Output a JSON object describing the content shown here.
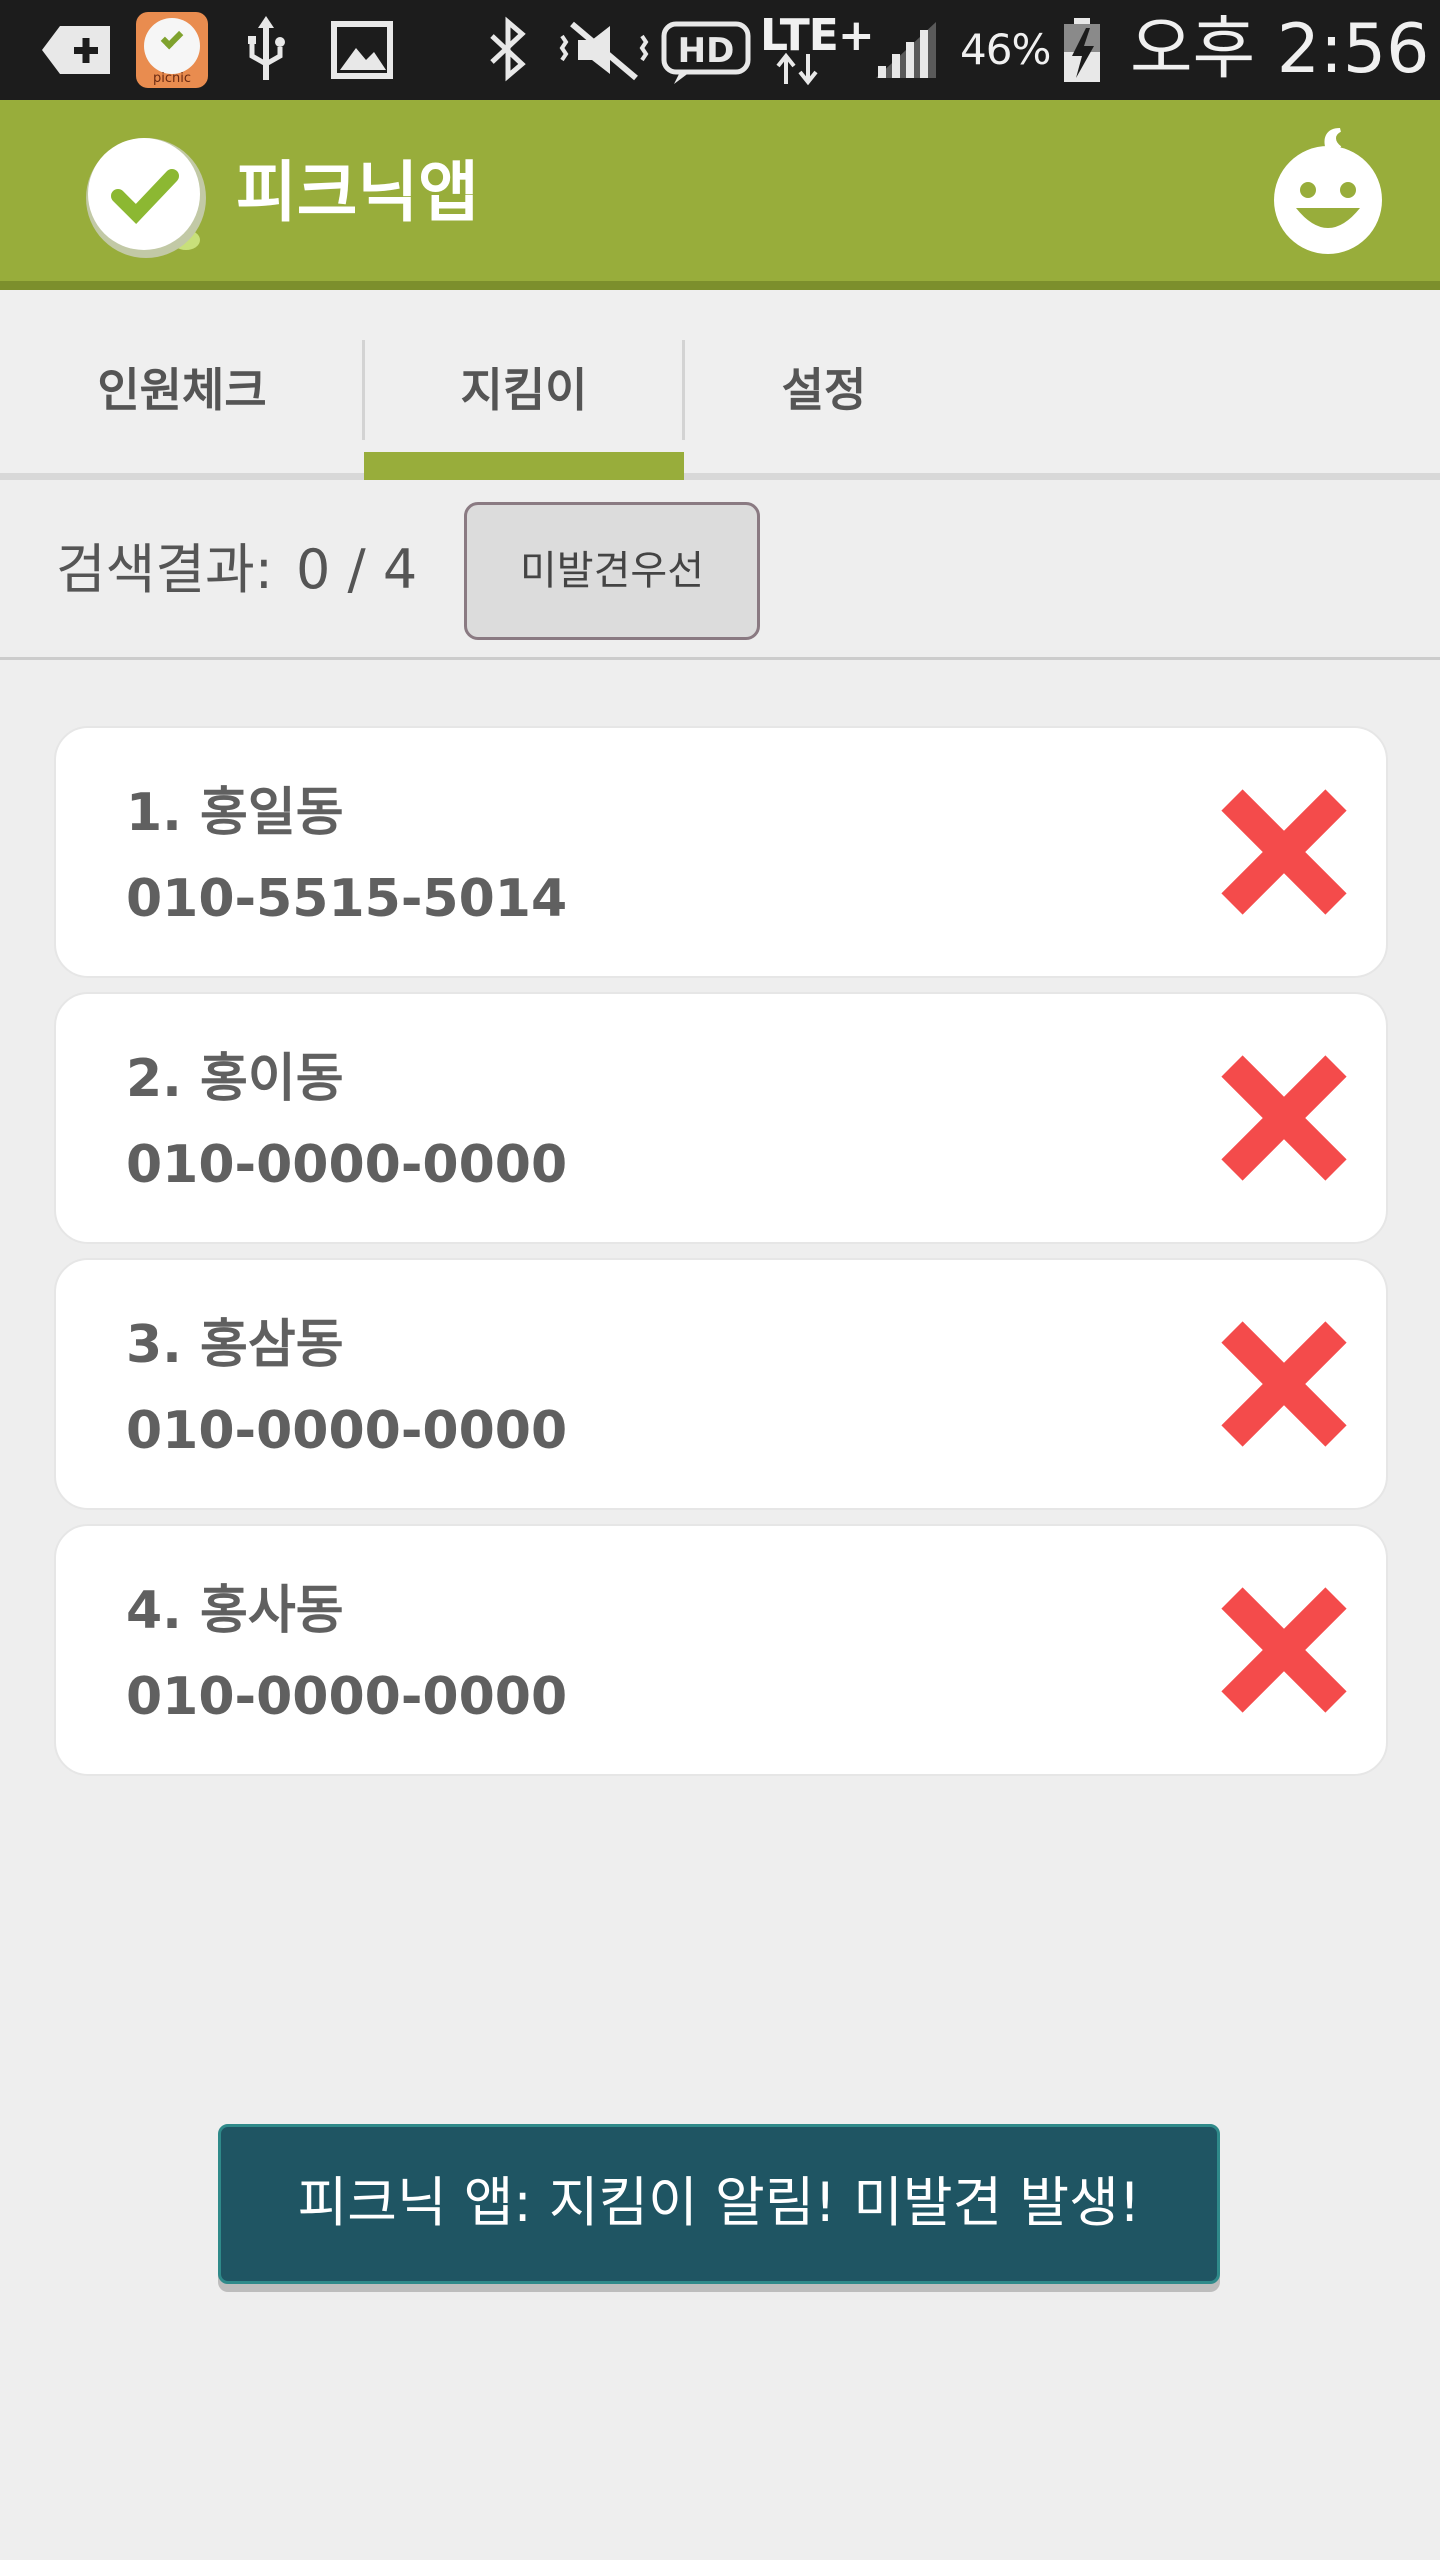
{
  "status_bar": {
    "app_badge_text": "picnic",
    "network": "LTE+",
    "battery_percent": "46%",
    "clock": "오후 2:56"
  },
  "action_bar": {
    "title": "피크닉앱"
  },
  "tabs": [
    {
      "label": "인원체크",
      "selected": false
    },
    {
      "label": "지킴이",
      "selected": true
    },
    {
      "label": "설정",
      "selected": false
    }
  ],
  "search": {
    "label": "검색결과:",
    "count": "0 / 4",
    "priority_button": "미발견우선"
  },
  "people": [
    {
      "name": "1. 홍일동",
      "phone": "010-5515-5014"
    },
    {
      "name": "2. 홍이동",
      "phone": "010-0000-0000"
    },
    {
      "name": "3. 홍삼동",
      "phone": "010-0000-0000"
    },
    {
      "name": "4. 홍사동",
      "phone": "010-0000-0000"
    }
  ],
  "toast": {
    "message": "피크닉 앱: 지킴이 알림! 미발견 발생!"
  },
  "colors": {
    "accent": "#98ad3b",
    "delete": "#f44b4b",
    "toast_bg": "#1f5563"
  }
}
